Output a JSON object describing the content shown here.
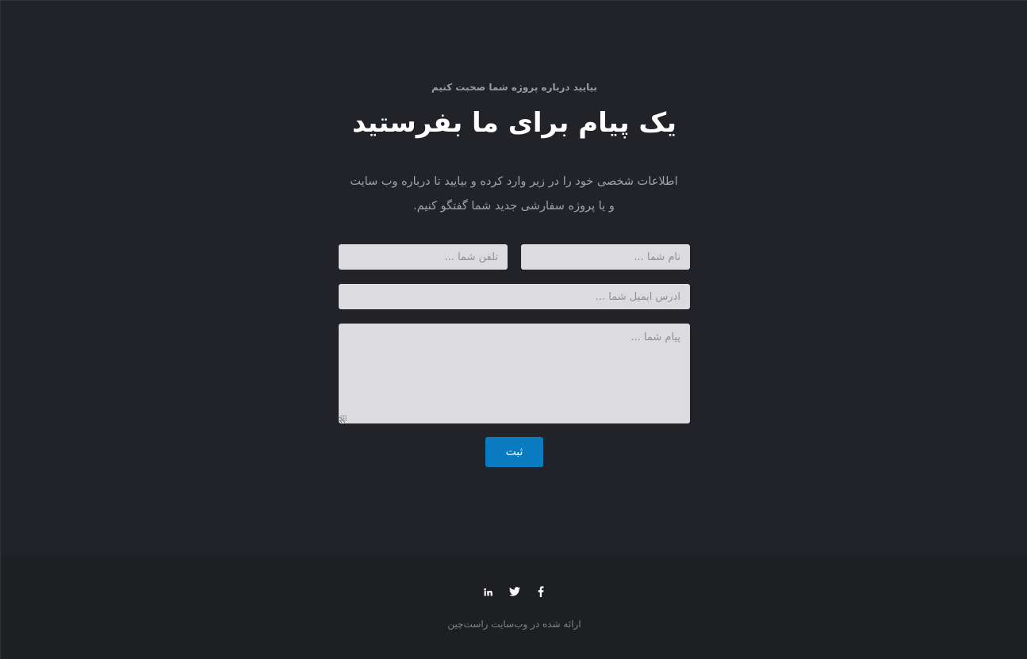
{
  "contact": {
    "eyebrow": "بیایید درباره پروژه شما صحبت کنیم",
    "title": "یک پیام برای ما بفرستید",
    "lead_line1": "اطلاعات شخصی خود را در زیر وارد کرده و بیایید تا درباره وب سایت",
    "lead_line2": "و یا پروژه سفارشی جدید شما گفتگو کنیم."
  },
  "form": {
    "name_placeholder": "نام شما ...",
    "phone_placeholder": "تلفن شما ...",
    "email_placeholder": "آدرس ایمیل شما ...",
    "message_placeholder": "پیام شما ...",
    "submit_label": "ثبت",
    "accent_color": "#0a7bc0"
  },
  "footer": {
    "social_icons": [
      "linkedin-icon",
      "twitter-icon",
      "facebook-icon"
    ],
    "copyright": "ارائه شده در وب‌سایت راست‌چین"
  }
}
